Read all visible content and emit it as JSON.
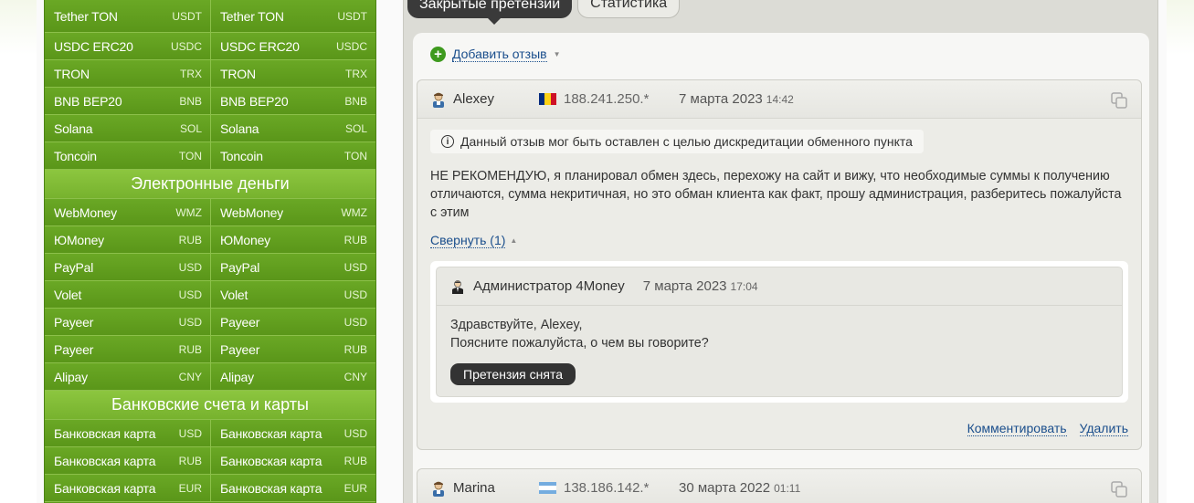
{
  "currencies": {
    "rows": [
      {
        "left": {
          "name": "Tether TON",
          "code": "USDT"
        },
        "right": {
          "name": "Tether TON",
          "code": "USDT"
        }
      },
      {
        "left": {
          "name": "USDC ERC20",
          "code": "USDC"
        },
        "right": {
          "name": "USDC ERC20",
          "code": "USDC"
        }
      },
      {
        "left": {
          "name": "TRON",
          "code": "TRX"
        },
        "right": {
          "name": "TRON",
          "code": "TRX"
        }
      },
      {
        "left": {
          "name": "BNB BEP20",
          "code": "BNB"
        },
        "right": {
          "name": "BNB BEP20",
          "code": "BNB"
        }
      },
      {
        "left": {
          "name": "Solana",
          "code": "SOL"
        },
        "right": {
          "name": "Solana",
          "code": "SOL"
        }
      },
      {
        "left": {
          "name": "Toncoin",
          "code": "TON"
        },
        "right": {
          "name": "Toncoin",
          "code": "TON"
        }
      }
    ],
    "emoney_title": "Электронные деньги",
    "emoney": [
      {
        "left": {
          "name": "WebMoney",
          "code": "WMZ"
        },
        "right": {
          "name": "WebMoney",
          "code": "WMZ"
        }
      },
      {
        "left": {
          "name": "ЮMoney",
          "code": "RUB"
        },
        "right": {
          "name": "ЮMoney",
          "code": "RUB"
        }
      },
      {
        "left": {
          "name": "PayPal",
          "code": "USD"
        },
        "right": {
          "name": "PayPal",
          "code": "USD"
        }
      },
      {
        "left": {
          "name": "Volet",
          "code": "USD"
        },
        "right": {
          "name": "Volet",
          "code": "USD"
        }
      },
      {
        "left": {
          "name": "Payeer",
          "code": "USD"
        },
        "right": {
          "name": "Payeer",
          "code": "USD"
        }
      },
      {
        "left": {
          "name": "Payeer",
          "code": "RUB"
        },
        "right": {
          "name": "Payeer",
          "code": "RUB"
        }
      },
      {
        "left": {
          "name": "Alipay",
          "code": "CNY"
        },
        "right": {
          "name": "Alipay",
          "code": "CNY"
        }
      }
    ],
    "bank_title": "Банковские счета и карты",
    "bank": [
      {
        "left": {
          "name": "Банковская карта",
          "code": "USD"
        },
        "right": {
          "name": "Банковская карта",
          "code": "USD"
        }
      },
      {
        "left": {
          "name": "Банковская карта",
          "code": "RUB"
        },
        "right": {
          "name": "Банковская карта",
          "code": "RUB"
        }
      },
      {
        "left": {
          "name": "Банковская карта",
          "code": "EUR"
        },
        "right": {
          "name": "Банковская карта",
          "code": "EUR"
        }
      }
    ]
  },
  "tabs": {
    "active": "Закрытые претензии",
    "inactive": "Статистика"
  },
  "add_review": "Добавить отзыв",
  "reviews": [
    {
      "author": "Alexey",
      "ip": "188.241.250.*",
      "date": "7 марта 2023",
      "time": "14:42",
      "warning": "Данный отзыв мог быть оставлен с целью дискредитации обменного пункта",
      "text": "НЕ РЕКОМЕНДУЮ, я планировал обмен здесь, перехожу на сайт и вижу, что необходимые суммы к получению отличаются, сумма некритичная, но это обман клиента как факт, прошу администрация, разберитесь пожалуйста с этим",
      "collapse": "Свернуть (1)",
      "reply": {
        "author": "Администратор 4Money",
        "date": "7 марта 2023",
        "time": "17:04",
        "line1": "Здравствуйте, Alexey,",
        "line2": "Поясните пожалуйста, о чем вы говорите?",
        "badge": "Претензия снята"
      },
      "comment": "Комментировать",
      "delete": "Удалить"
    },
    {
      "author": "Marina",
      "ip": "138.186.142.*",
      "date": "30 марта 2022",
      "time": "01:11"
    }
  ],
  "colors": {
    "accent_green": "#6aa825",
    "link": "#1a4e8c",
    "badge": "#333333"
  }
}
